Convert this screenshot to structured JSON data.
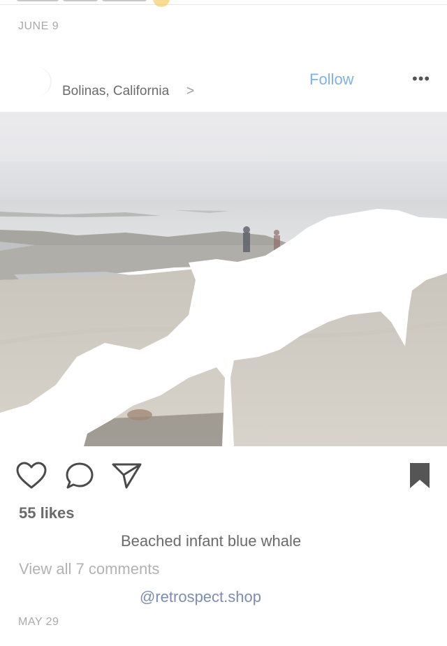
{
  "prev_post": {
    "date": "JUNE 9"
  },
  "post": {
    "location": "Bolinas, California",
    "location_chevron": ">",
    "follow_label": "Follow",
    "more_label": "•••",
    "icons": {
      "like": "heart-icon",
      "comment": "comment-icon",
      "share": "send-icon",
      "save": "bookmark-icon"
    },
    "likes": "55 likes",
    "caption": "Beached infant blue whale",
    "view_comments": "View all 7 comments",
    "mention": "@retrospect.shop",
    "date": "MAY 29"
  },
  "colors": {
    "follow": "#7fb1ea",
    "mention": "#7d8cb0",
    "muted": "#a9a9a9"
  }
}
